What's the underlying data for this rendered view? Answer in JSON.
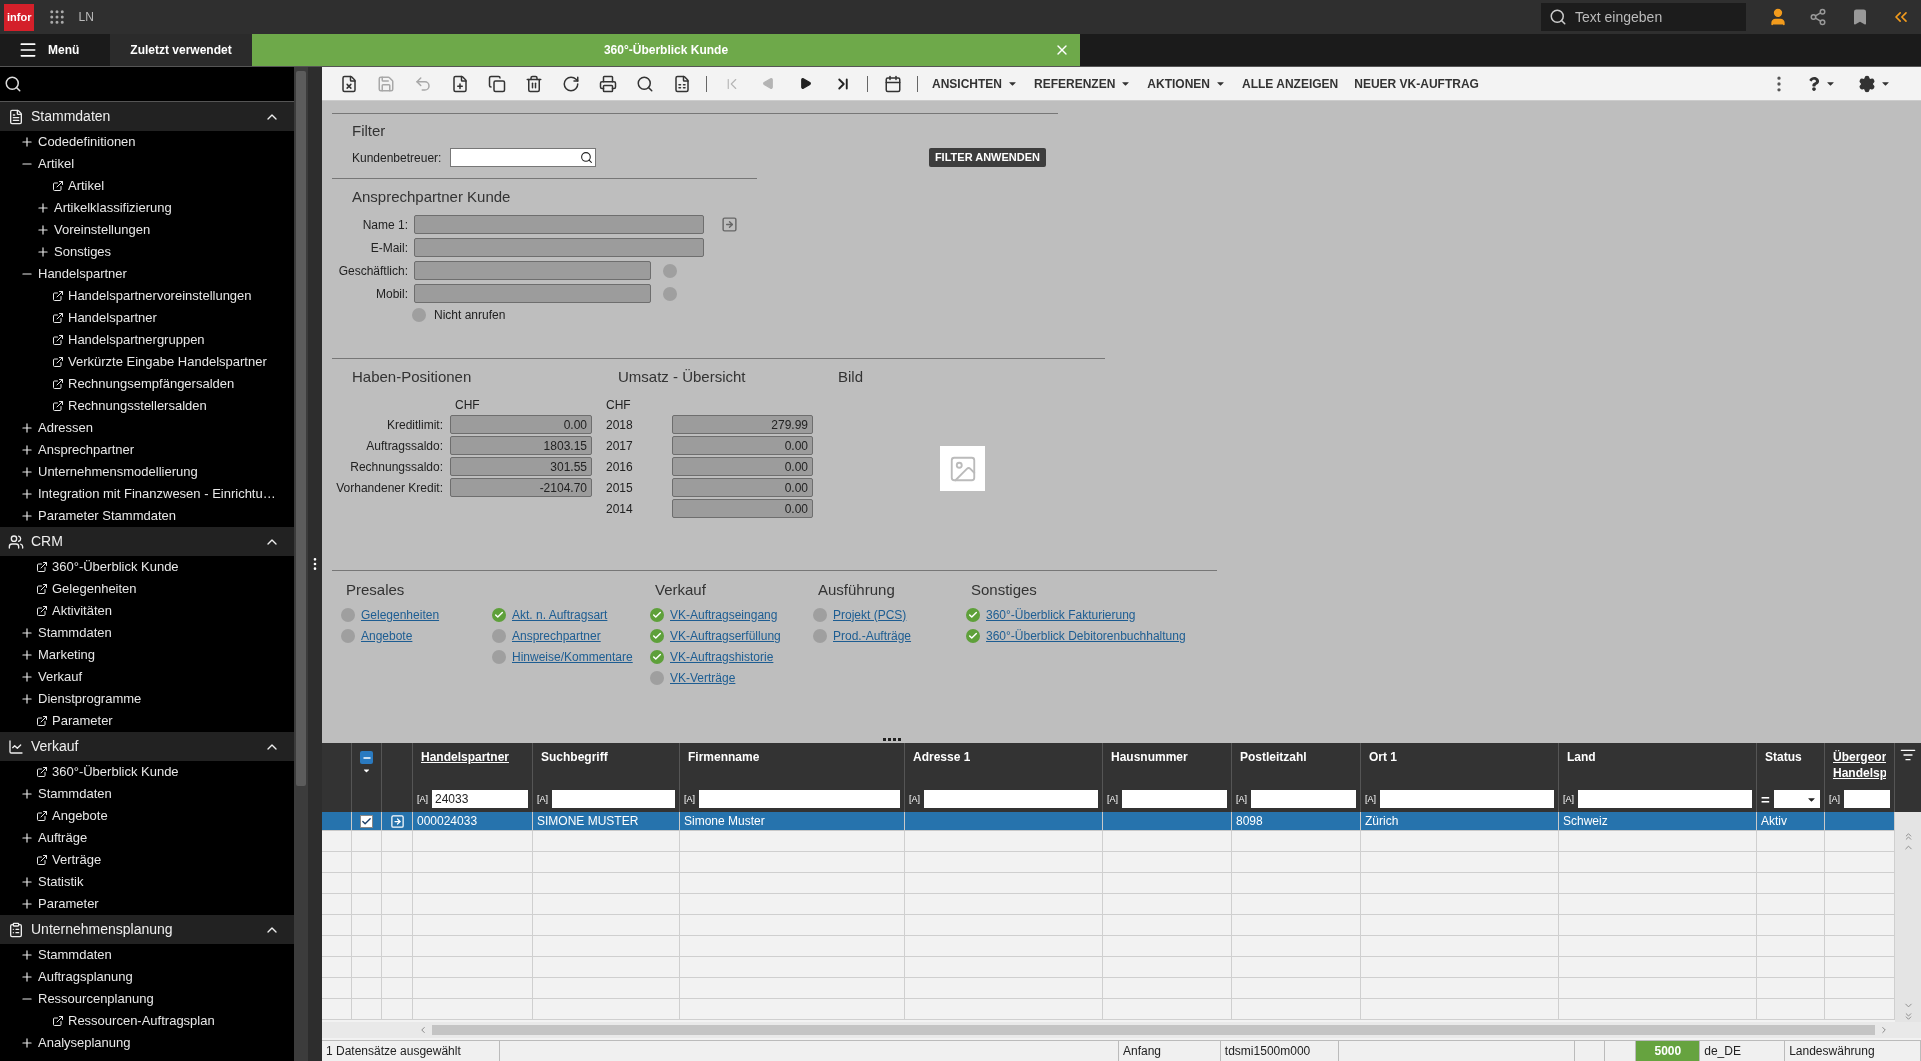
{
  "top_bar": {
    "logo": "infor",
    "app": "LN",
    "search": {
      "placeholder": "Text eingeben"
    }
  },
  "tab_bar": {
    "menu": "Menü",
    "tabs": [
      {
        "label": "Zuletzt verwendet",
        "kind": "recent",
        "selected": false
      },
      {
        "label": "360°-Überblick Kunde",
        "kind": "document",
        "selected": true
      }
    ]
  },
  "sidebar": {
    "sections": [
      {
        "title": "Stammdaten",
        "expanded": true,
        "items": [
          {
            "label": "Codedefinitionen",
            "kind": "folder",
            "expanded": false
          },
          {
            "label": "Artikel",
            "kind": "folder",
            "expanded": true,
            "children": [
              {
                "label": "Artikel",
                "kind": "link"
              },
              {
                "label": "Artikelklassifizierung",
                "kind": "folder",
                "expanded": false
              },
              {
                "label": "Voreinstellungen",
                "kind": "folder",
                "expanded": false
              },
              {
                "label": "Sonstiges",
                "kind": "folder",
                "expanded": false
              }
            ]
          },
          {
            "label": "Handelspartner",
            "kind": "folder",
            "expanded": true,
            "children": [
              {
                "label": "Handelspartnervoreinstellungen",
                "kind": "link"
              },
              {
                "label": "Handelspartner",
                "kind": "link"
              },
              {
                "label": "Handelspartnergruppen",
                "kind": "link"
              },
              {
                "label": "Verkürzte Eingabe Handelspartner",
                "kind": "link"
              },
              {
                "label": "Rechnungsempfängersalden",
                "kind": "link"
              },
              {
                "label": "Rechnungsstellersalden",
                "kind": "link"
              }
            ]
          },
          {
            "label": "Adressen",
            "kind": "folder",
            "expanded": false
          },
          {
            "label": "Ansprechpartner",
            "kind": "folder",
            "expanded": false
          },
          {
            "label": "Unternehmensmodellierung",
            "kind": "folder",
            "expanded": false
          },
          {
            "label": "Integration mit Finanzwesen - Einrichtu…",
            "kind": "folder",
            "expanded": false
          },
          {
            "label": "Parameter Stammdaten",
            "kind": "folder",
            "expanded": false
          }
        ]
      },
      {
        "title": "CRM",
        "expanded": true,
        "items": [
          {
            "label": "360°-Überblick Kunde",
            "kind": "link"
          },
          {
            "label": "Gelegenheiten",
            "kind": "link"
          },
          {
            "label": "Aktivitäten",
            "kind": "link"
          },
          {
            "label": "Stammdaten",
            "kind": "folder",
            "expanded": false
          },
          {
            "label": "Marketing",
            "kind": "folder",
            "expanded": false
          },
          {
            "label": "Verkauf",
            "kind": "folder",
            "expanded": false
          },
          {
            "label": "Dienstprogramme",
            "kind": "folder",
            "expanded": false
          },
          {
            "label": "Parameter",
            "kind": "link"
          }
        ]
      },
      {
        "title": "Verkauf",
        "expanded": true,
        "items": [
          {
            "label": "360°-Überblick Kunde",
            "kind": "link"
          },
          {
            "label": "Stammdaten",
            "kind": "folder",
            "expanded": false
          },
          {
            "label": "Angebote",
            "kind": "link"
          },
          {
            "label": "Aufträge",
            "kind": "folder",
            "expanded": false
          },
          {
            "label": "Verträge",
            "kind": "link"
          },
          {
            "label": "Statistik",
            "kind": "folder",
            "expanded": false
          },
          {
            "label": "Parameter",
            "kind": "folder",
            "expanded": false
          }
        ]
      },
      {
        "title": "Unternehmensplanung",
        "expanded": true,
        "items": [
          {
            "label": "Stammdaten",
            "kind": "folder",
            "expanded": false
          },
          {
            "label": "Auftragsplanung",
            "kind": "folder",
            "expanded": false
          },
          {
            "label": "Ressourcenplanung",
            "kind": "folder",
            "expanded": true,
            "children": [
              {
                "label": "Ressourcen-Auftragsplan",
                "kind": "link"
              }
            ]
          },
          {
            "label": "Analyseplanung",
            "kind": "folder",
            "expanded": false
          }
        ]
      }
    ]
  },
  "toolbar": {
    "icons": [
      {
        "disabled": false
      },
      {
        "disabled": true
      },
      {
        "disabled": true
      },
      {
        "disabled": false
      },
      {
        "disabled": false
      },
      {
        "disabled": false
      },
      {
        "disabled": false
      },
      {
        "disabled": false
      },
      {
        "disabled": false
      },
      {
        "disabled": false
      }
    ],
    "nav_icons": [
      {
        "disabled": true
      },
      {
        "disabled": true
      },
      {
        "disabled": false
      },
      {
        "disabled": false
      }
    ],
    "menus": [
      "ANSICHTEN",
      "REFERENZEN",
      "AKTIONEN"
    ],
    "buttons": [
      "ALLE ANZEIGEN",
      "NEUER VK-AUFTRAG"
    ]
  },
  "filter": {
    "title": "Filter",
    "field": {
      "label": "Kundenbetreuer:"
    },
    "button": "FILTER ANWENDEN"
  },
  "contact": {
    "title": "Ansprechpartner Kunde",
    "fields": [
      {
        "label": "Name 1:",
        "kind": "link"
      },
      {
        "label": "E-Mail:",
        "kind": "text"
      },
      {
        "label": "Geschäftlich:",
        "kind": "phone"
      },
      {
        "label": "Mobil:",
        "kind": "phone"
      }
    ],
    "do_not_call": {
      "label": "Nicht anrufen",
      "checked": false
    }
  },
  "credit": {
    "title": "Haben-Positionen",
    "currency": "CHF",
    "rows": [
      {
        "label": "Kreditlimit:",
        "value": "0.00"
      },
      {
        "label": "Auftragssaldo:",
        "value": "1803.15"
      },
      {
        "label": "Rechnungssaldo:",
        "value": "301.55"
      },
      {
        "label": "Vorhandener Kredit:",
        "value": "-2104.70"
      }
    ]
  },
  "revenue": {
    "title": "Umsatz - Übersicht",
    "currency": "CHF",
    "rows": [
      {
        "year": "2018",
        "value": "279.99"
      },
      {
        "year": "2017",
        "value": "0.00"
      },
      {
        "year": "2016",
        "value": "0.00"
      },
      {
        "year": "2015",
        "value": "0.00"
      },
      {
        "year": "2014",
        "value": "0.00"
      }
    ]
  },
  "image": {
    "title": "Bild"
  },
  "link_groups": [
    {
      "title": "Presales",
      "items": [
        {
          "label": "Gelegenheiten",
          "done": false
        },
        {
          "label": "Angebote",
          "done": false
        }
      ]
    },
    {
      "items": [
        {
          "label": "Akt. n. Auftragsart",
          "done": true
        },
        {
          "label": "Ansprechpartner",
          "done": false
        },
        {
          "label": "Hinweise/Kommentare",
          "done": false
        }
      ]
    },
    {
      "title": "Verkauf",
      "items": [
        {
          "label": "VK-Auftragseingang",
          "done": true
        },
        {
          "label": "VK-Auftragserfüllung",
          "done": true
        },
        {
          "label": "VK-Auftragshistorie",
          "done": true
        },
        {
          "label": "VK-Verträge",
          "done": false
        }
      ]
    },
    {
      "title": "Ausführung",
      "items": [
        {
          "label": "Projekt (PCS)",
          "done": false
        },
        {
          "label": "Prod.-Aufträge",
          "done": false
        }
      ]
    },
    {
      "title": "Sonstiges",
      "items": [
        {
          "label": "360°-Überblick Fakturierung",
          "done": true
        },
        {
          "label": "360°-Überblick Debitorenbuchhaltung",
          "done": true
        }
      ]
    }
  ],
  "table": {
    "select_all": {
      "indeterminate": true
    },
    "columns": [
      {
        "label": "Handelspartner",
        "underlined": true,
        "filter": {
          "operator": "[A]",
          "value": "24033"
        }
      },
      {
        "label": "Suchbegriff",
        "underlined": false,
        "filter": {
          "operator": "[A]"
        }
      },
      {
        "label": "Firmenname",
        "underlined": false,
        "filter": {
          "operator": "[A]"
        }
      },
      {
        "label": "Adresse 1",
        "underlined": false,
        "filter": {
          "operator": "[A]"
        }
      },
      {
        "label": "Hausnummer",
        "underlined": false,
        "filter": {
          "operator": "[A]"
        }
      },
      {
        "label": "Postleitzahl",
        "underlined": false,
        "filter": {
          "operator": "[A]"
        }
      },
      {
        "label": "Ort 1",
        "underlined": false,
        "filter": {
          "operator": "[A]"
        }
      },
      {
        "label": "Land",
        "underlined": false,
        "filter": {
          "operator": "[A]"
        }
      },
      {
        "label": "Status",
        "underlined": false,
        "filter": {
          "operator": "=",
          "kind": "select"
        }
      },
      {
        "label": "Übergeor",
        "label_2": "Handelsp",
        "underlined": true,
        "filter": {
          "operator": "[A]"
        }
      }
    ],
    "rows": [
      {
        "selected": true,
        "checked": true,
        "cells": [
          "000024033",
          "SIMONE MUSTER",
          "Simone Muster",
          null,
          null,
          "8098",
          "Zürich",
          "Schweiz",
          "Aktiv",
          null
        ]
      }
    ]
  },
  "status_bar": [
    {
      "text": "1 Datensätze ausgewählt",
      "highlight": false
    },
    {
      "text": "Anfang",
      "highlight": false
    },
    {
      "text": "tdsmi1500m000",
      "highlight": false
    },
    {
      "text": "5000",
      "highlight": true
    },
    {
      "text": "de_DE",
      "highlight": false
    },
    {
      "text": "Landeswährung",
      "highlight": false
    }
  ]
}
